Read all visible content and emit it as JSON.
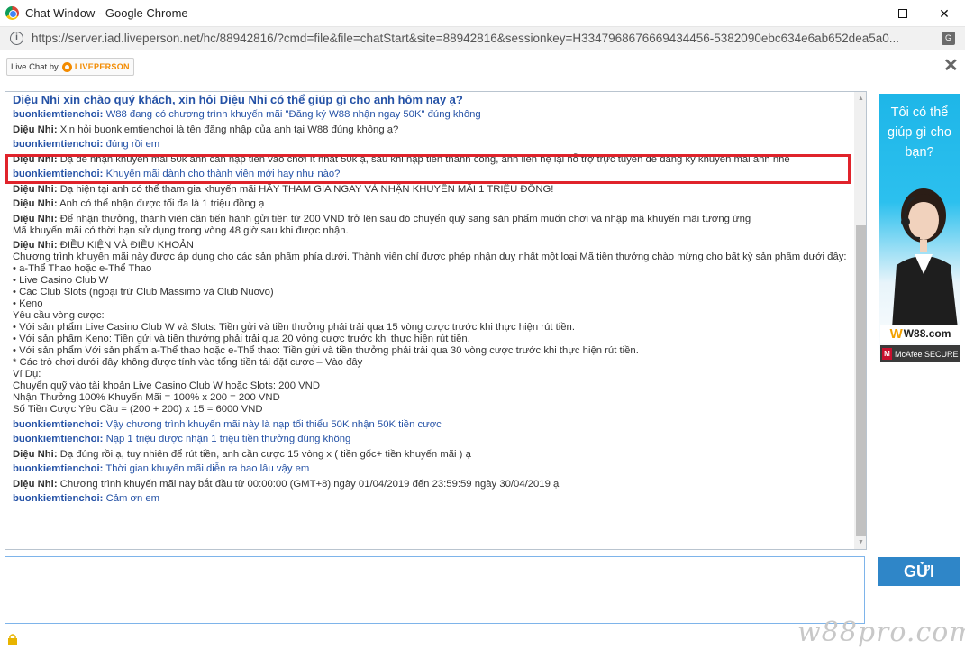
{
  "window": {
    "title": "Chat Window - Google Chrome",
    "url": "https://server.iad.liveperson.net/hc/88942816/?cmd=file&file=chatStart&site=88942816&sessionkey=H3347968676669434456-5382090ebc634e6ab652dea5a0..."
  },
  "header": {
    "live_chat_by": "Live Chat by",
    "brand": "LIVEPERSON"
  },
  "agent_name": "Diệu Nhi:",
  "visitor_name": "buonkiemtienchoi:",
  "transcript": {
    "greeting": "Diệu Nhi xin chào quý khách, xin hỏi Diệu Nhi có thể giúp gì cho anh hôm nay ạ?",
    "messages": [
      {
        "who": "visitor",
        "text": "W88 đang có chương trình khuyến mãi \"Đăng ký W88 nhận ngay 50K\" đúng không"
      },
      {
        "who": "agent",
        "text": "Xin hỏi buonkiemtienchoi là tên đăng nhập của anh tại W88 đúng không ạ?"
      },
      {
        "who": "visitor",
        "text": "đúng rồi em"
      },
      {
        "who": "agent",
        "text": "Dạ để nhận khuyến mãi 50k anh cần nạp tiền vào chơi ít nhất 50k ạ, sau khi nạp tiền thành công, anh liên hệ lại hỗ trợ trực tuyến để đăng ký khuyến mãi anh nhé"
      },
      {
        "who": "visitor",
        "text": "Khuyến mãi dành cho thành viên mới hay như nào?"
      },
      {
        "who": "agent",
        "text": "Dạ hiện tại anh có thể tham gia khuyến mãi HÃY THAM GIA NGAY VÀ NHẬN KHUYẾN MÃI 1 TRIỆU ĐỒNG!"
      },
      {
        "who": "agent",
        "text": "Anh có thể nhận được tối đa là 1 triệu đồng ạ"
      },
      {
        "who": "agent",
        "text": "Để nhận thưởng, thành viên cần tiến hành gửi tiền từ 200 VND trở lên sau đó chuyển quỹ sang sản phẩm muốn chơi và nhập mã khuyến mãi tương ứng\nMã khuyến mãi có thời hạn sử dụng trong vòng 48 giờ sau khi được nhận."
      },
      {
        "who": "agent",
        "text": "ĐIỀU KIỆN VÀ ĐIỀU KHOẢN\nChương trình khuyến mãi này được áp dụng cho các sản phẩm phía dưới. Thành viên chỉ được phép nhận duy nhất một loại Mã tiền thưởng chào mừng cho bất kỳ sản phẩm dưới đây:\n• a-Thể Thao hoặc e-Thể Thao\n• Live Casino Club W\n• Các Club Slots (ngoại trừ Club Massimo và Club Nuovo)\n• Keno\nYêu cầu vòng cược:\n• Với sản phẩm Live Casino Club W và Slots: Tiền gửi và tiền thưởng phải trải qua 15 vòng cược trước khi thực hiện rút tiền.\n• Với sản phẩm Keno: Tiền gửi và tiền thưởng phải trải qua 20 vòng cược trước khi thực hiện rút tiền.\n• Với sản phẩm Với sản phẩm a-Thể thao hoặc e-Thể thao: Tiền gửi và tiền thưởng phải trải qua 30 vòng cược trước khi thực hiện rút tiền.\n* Các trò chơi dưới đây không được tính vào tổng tiền tái đặt cược – Vào đây\nVí Dụ:\nChuyển quỹ vào tài khoản Live Casino Club W hoặc Slots: 200 VND\nNhận Thưởng 100% Khuyến Mãi = 100% x 200 = 200 VND\nSố Tiền Cược Yêu Cầu = (200 + 200) x 15 = 6000 VND"
      },
      {
        "who": "visitor",
        "text": "Vậy chương trình khuyến mãi này là nạp tối thiểu 50K nhận 50K tiền cược"
      },
      {
        "who": "visitor",
        "text": "Nạp 1 triệu được nhận 1 triệu tiền thưởng đúng không"
      },
      {
        "who": "agent",
        "text": "Dạ đúng rồi ạ, tuy nhiên để rút tiền, anh cần cược 15 vòng x ( tiền gốc+ tiền khuyến mãi ) ạ"
      },
      {
        "who": "visitor",
        "text": "Thời gian khuyến mãi diễn ra bao lâu vậy em"
      },
      {
        "who": "agent",
        "text": "Chương trình khuyến mãi này bắt đầu từ 00:00:00 (GMT+8) ngày 01/04/2019 đến 23:59:59 ngày 30/04/2019 ạ"
      },
      {
        "who": "visitor",
        "text": "Cảm ơn em"
      }
    ]
  },
  "ad": {
    "text": "Tôi có thể giúp gì cho bạn?",
    "w88_w": "W",
    "w88_rest": "W88.com",
    "mcafee": "McAfee SECURE"
  },
  "input": {
    "value": ""
  },
  "send_button": "GỬI",
  "watermark": "w88pro.com",
  "colors": {
    "visitor": "#2552a6",
    "highlight": "#e0232b",
    "send": "#2f86c8",
    "accent": "#f38b00"
  }
}
